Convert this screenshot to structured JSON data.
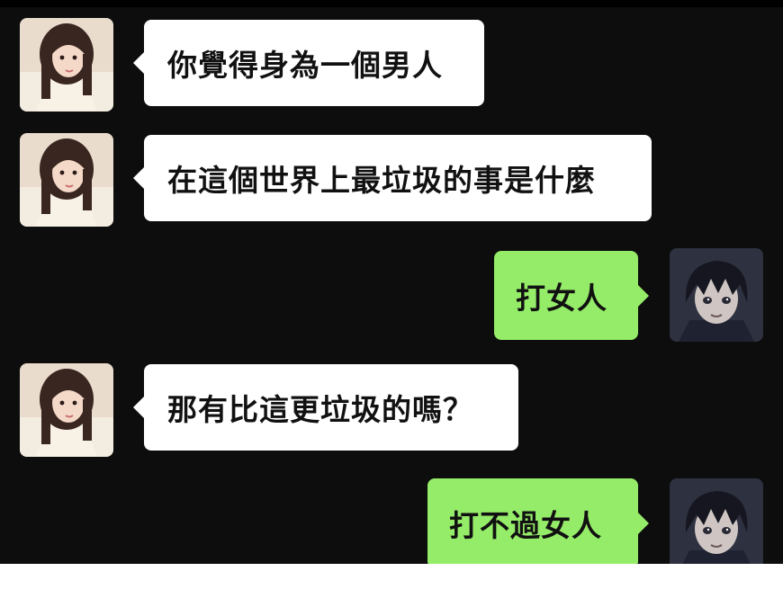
{
  "conversation": {
    "messages": [
      {
        "side": "left",
        "sender": "girl",
        "text": "你覺得身為一個男人"
      },
      {
        "side": "left",
        "sender": "girl",
        "text": "在這個世界上最垃圾的事是什麼"
      },
      {
        "side": "right",
        "sender": "boy",
        "text": "打女人"
      },
      {
        "side": "left",
        "sender": "girl",
        "text": "那有比這更垃圾的嗎？"
      },
      {
        "side": "right",
        "sender": "boy",
        "text": "打不過女人"
      }
    ]
  },
  "avatars": {
    "left": "girl-avatar-icon",
    "right": "anime-boy-avatar-icon"
  },
  "colors": {
    "background": "#0d0d0d",
    "left_bubble": "#ffffff",
    "right_bubble": "#95ec69",
    "text": "#111111"
  }
}
